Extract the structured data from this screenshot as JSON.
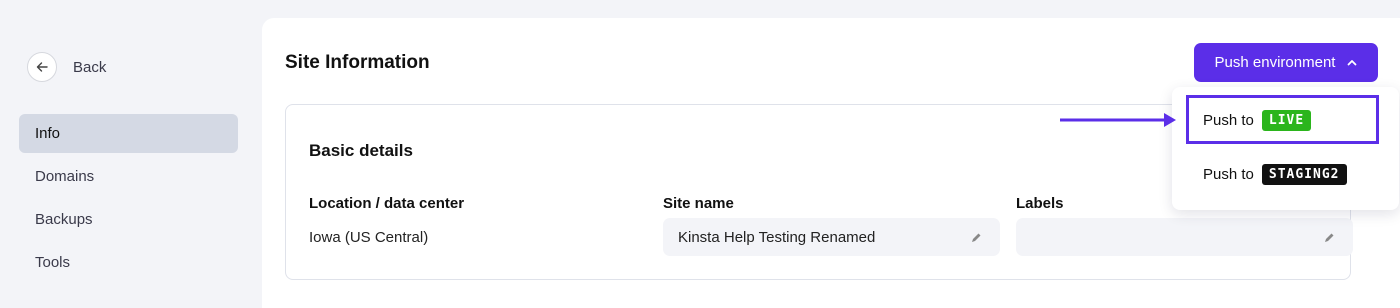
{
  "sidebar": {
    "back_label": "Back",
    "items": [
      {
        "label": "Info",
        "active": true
      },
      {
        "label": "Domains",
        "active": false
      },
      {
        "label": "Backups",
        "active": false
      },
      {
        "label": "Tools",
        "active": false
      }
    ]
  },
  "main": {
    "title": "Site Information",
    "push_button": {
      "label": "Push environment",
      "icon": "chevron-up-icon"
    },
    "section": {
      "title": "Basic details",
      "fields": {
        "location": {
          "label": "Location / data center",
          "value": "Iowa (US Central)"
        },
        "site_name": {
          "label": "Site name",
          "value": "Kinsta Help Testing Renamed"
        },
        "labels": {
          "label": "Labels",
          "value": ""
        }
      }
    }
  },
  "dropdown": {
    "items": [
      {
        "prefix": "Push to",
        "badge": "LIVE",
        "badge_color": "#2bb51c",
        "highlighted": true
      },
      {
        "prefix": "Push to",
        "badge": "STAGING2",
        "badge_color": "#111111",
        "highlighted": false
      }
    ]
  },
  "colors": {
    "accent": "#5b2ee8",
    "live": "#2bb51c",
    "sidebar_active": "#d4d9e4"
  }
}
